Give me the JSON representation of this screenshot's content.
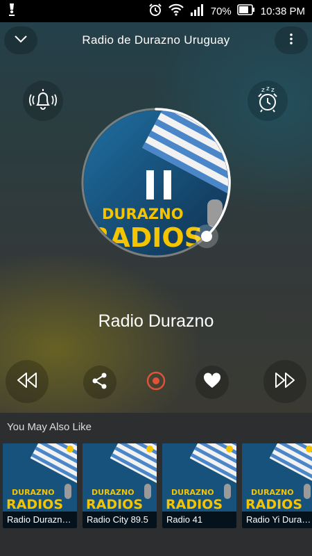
{
  "status": {
    "battery": "70%",
    "time": "10:38 PM"
  },
  "header": {
    "title": "Radio de Durazno Uruguay"
  },
  "player": {
    "station_name": "Radio Durazno",
    "artwork_line1": "DURAZNO",
    "artwork_line2": "RADIOS",
    "playback_progress": 0.38,
    "state": "playing"
  },
  "controls": {
    "accent_color": "#e0533a"
  },
  "suggestions": {
    "title": "You May Also Like",
    "items": [
      {
        "label": "Radio Durazno Uruguay",
        "line1": "DURAZNO",
        "line2": "RADIOS"
      },
      {
        "label": "Radio City 89.5",
        "line1": "DURAZNO",
        "line2": "RADIOS"
      },
      {
        "label": "Radio 41",
        "line1": "DURAZNO",
        "line2": "RADIOS"
      },
      {
        "label": "Radio Yi Durazno",
        "line1": "DURAZNO",
        "line2": "RADIOS"
      }
    ]
  }
}
